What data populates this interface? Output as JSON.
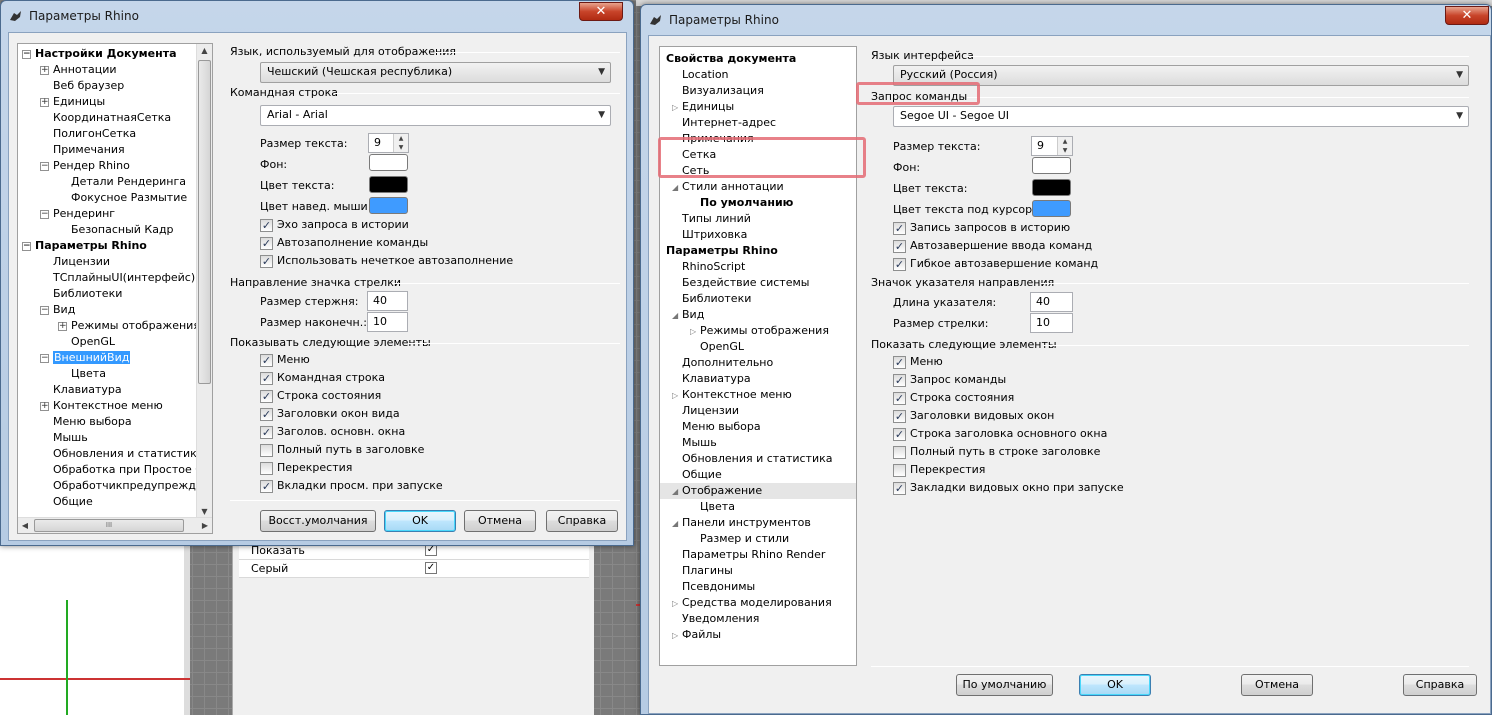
{
  "background": {
    "props_rows": [
      {
        "label": "Показать",
        "checked": true
      },
      {
        "label": "Серый",
        "checked": true
      }
    ]
  },
  "left_window": {
    "title": "Параметры Rhino",
    "close_glyph": "✕",
    "tree": [
      {
        "label": "Настройки Документа",
        "bold": true,
        "expander": "−"
      },
      {
        "label": "Аннотации",
        "expander": "+"
      },
      {
        "label": "Веб браузер"
      },
      {
        "label": "Единицы",
        "expander": "+"
      },
      {
        "label": "КоординатнаяСетка"
      },
      {
        "label": "ПолигонСетка"
      },
      {
        "label": "Примечания"
      },
      {
        "label": "Рендер Rhino",
        "expander": "−"
      },
      {
        "label": "Детали Рендеринга"
      },
      {
        "label": "Фокусное Размытие"
      },
      {
        "label": "Рендеринг",
        "expander": "−"
      },
      {
        "label": "Безопасный Кадр"
      },
      {
        "label": "Параметры Rhino",
        "bold": true,
        "expander": "−"
      },
      {
        "label": "Лицензии"
      },
      {
        "label": "ТСплайныUI(интерфейс)"
      },
      {
        "label": "Библиотеки"
      },
      {
        "label": "Вид",
        "expander": "−"
      },
      {
        "label": "Режимы отображения",
        "expander": "+"
      },
      {
        "label": "OpenGL"
      },
      {
        "label": "ВнешнийВид",
        "expander": "−",
        "selected": true
      },
      {
        "label": "Цвета"
      },
      {
        "label": "Клавиатура"
      },
      {
        "label": "Контекстное меню",
        "expander": "+"
      },
      {
        "label": "Меню выбора"
      },
      {
        "label": "Мышь"
      },
      {
        "label": "Обновления и статистика"
      },
      {
        "label": "Обработка при Простое С"
      },
      {
        "label": "Обработчикпредупрежден"
      },
      {
        "label": "Общие"
      }
    ],
    "hscroll_grip": "III",
    "lang_group": "Язык, используемый для отображения",
    "lang_value": "Чешский (Чешская республика)",
    "cmd_group": "Командная строка",
    "font_value": "Arial - Arial",
    "text_size_label": "Размер текста:",
    "text_size_value": "9",
    "bg_label": "Фон:",
    "text_color_label": "Цвет текста:",
    "hover_color_label": "Цвет навед. мыши",
    "colors": {
      "bg": "#ffffff",
      "text": "#000000",
      "hover": "#3f9bff"
    },
    "cmd_checks": [
      {
        "label": "Эхо запроса в истории",
        "checked": true
      },
      {
        "label": "Автозаполнение команды",
        "checked": true
      },
      {
        "label": "Использовать нечеткое автозаполнение",
        "checked": true
      }
    ],
    "arrow_group": "Направление значка стрелки",
    "shaft_label": "Размер стержня:",
    "shaft_value": "40",
    "head_label": "Размер наконечн.:",
    "head_value": "10",
    "show_group": "Показывать следующие элементы",
    "show_checks": [
      {
        "label": "Меню",
        "checked": true
      },
      {
        "label": "Командная строка",
        "checked": true
      },
      {
        "label": "Строка состояния",
        "checked": true
      },
      {
        "label": "Заголовки окон вида",
        "checked": true
      },
      {
        "label": "Заголов. основн. окна",
        "checked": true
      },
      {
        "label": "Полный путь в заголовке",
        "checked": false
      },
      {
        "label": "Перекрестия",
        "checked": false
      },
      {
        "label": "Вкладки просм. при запуске",
        "checked": true
      }
    ],
    "buttons": {
      "restore": "Восст.умолчания",
      "ok": "OK",
      "cancel": "Отмена",
      "help": "Справка"
    }
  },
  "right_window": {
    "title": "Параметры Rhino",
    "close_glyph": "✕",
    "tree": [
      {
        "label": "Свойства документа",
        "bold": true
      },
      {
        "label": "Location"
      },
      {
        "label": "Визуализация"
      },
      {
        "label": "Единицы",
        "expander": "▷"
      },
      {
        "label": "Интернет-адрес"
      },
      {
        "label": "Примечания"
      },
      {
        "label": "Сетка"
      },
      {
        "label": "Сеть"
      },
      {
        "label": "Стили аннотации",
        "expander": "◢"
      },
      {
        "label": "По умолчанию",
        "bold": true
      },
      {
        "label": "Типы линий"
      },
      {
        "label": "Штриховка"
      },
      {
        "label": "Параметры Rhino",
        "bold": true
      },
      {
        "label": "RhinoScript"
      },
      {
        "label": "Бездействие системы"
      },
      {
        "label": "Библиотеки"
      },
      {
        "label": "Вид",
        "expander": "◢"
      },
      {
        "label": "Режимы отображения",
        "expander": "▷"
      },
      {
        "label": "OpenGL"
      },
      {
        "label": "Дополнительно"
      },
      {
        "label": "Клавиатура"
      },
      {
        "label": "Контекстное меню",
        "expander": "▷"
      },
      {
        "label": "Лицензии"
      },
      {
        "label": "Меню выбора"
      },
      {
        "label": "Мышь"
      },
      {
        "label": "Обновления и статистика"
      },
      {
        "label": "Общие"
      },
      {
        "label": "Отображение",
        "expander": "◢",
        "highlight": true
      },
      {
        "label": "Цвета"
      },
      {
        "label": "Панели инструментов",
        "expander": "◢"
      },
      {
        "label": "Размер и стили"
      },
      {
        "label": "Параметры Rhino Render"
      },
      {
        "label": "Плагины"
      },
      {
        "label": "Псевдонимы"
      },
      {
        "label": "Средства моделирования",
        "expander": "▷"
      },
      {
        "label": "Уведомления"
      },
      {
        "label": "Файлы",
        "expander": "▷"
      }
    ],
    "lang_group": "Язык интерфейса",
    "lang_value": "Русский (Россия)",
    "cmd_group": "Запрос команды",
    "font_value": "Segoe UI - Segoe UI",
    "text_size_label": "Размер текста:",
    "text_size_value": "9",
    "bg_label": "Фон:",
    "text_color_label": "Цвет текста:",
    "hover_color_label": "Цвет текста под курсором:",
    "colors": {
      "bg": "#ffffff",
      "text": "#000000",
      "hover": "#3f9bff"
    },
    "cmd_checks": [
      {
        "label": "Запись запросов в историю",
        "checked": true
      },
      {
        "label": "Автозавершение ввода команд",
        "checked": true
      },
      {
        "label": "Гибкое автозавершение команд",
        "checked": true
      }
    ],
    "arrow_group": "Значок указателя направления",
    "shaft_label": "Длина указателя:",
    "shaft_value": "40",
    "head_label": "Размер стрелки:",
    "head_value": "10",
    "show_group": "Показать следующие элементы",
    "show_checks": [
      {
        "label": "Меню",
        "checked": true
      },
      {
        "label": "Запрос команды",
        "checked": true
      },
      {
        "label": "Строка состояния",
        "checked": true
      },
      {
        "label": "Заголовки видовых окон",
        "checked": true
      },
      {
        "label": "Строка заголовка основного окна",
        "checked": true
      },
      {
        "label": "Полный путь в строке заголовке",
        "checked": false
      },
      {
        "label": "Перекрестия",
        "checked": false
      },
      {
        "label": "Закладки видовых окно при запуске",
        "checked": true
      }
    ],
    "buttons": {
      "restore": "По умолчанию",
      "ok": "OK",
      "cancel": "Отмена",
      "help": "Справка"
    }
  },
  "accent": {
    "selection": "#3399ff",
    "annotation_red": "#e46b74"
  }
}
